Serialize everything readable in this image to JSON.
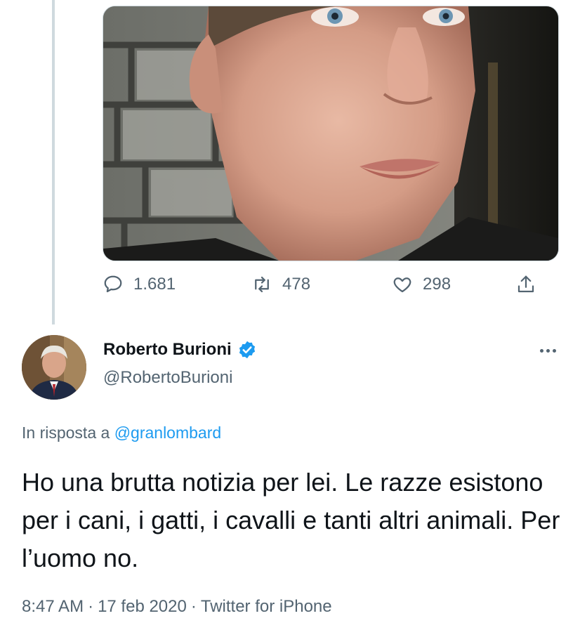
{
  "quoted_tweet": {
    "stats": {
      "replies": "1.681",
      "retweets": "478",
      "likes": "298"
    }
  },
  "tweet": {
    "author": {
      "display_name": "Roberto Burioni",
      "handle": "@RobertoBurioni",
      "verified": true
    },
    "reply_prefix": "In risposta a",
    "reply_to": "@granlombard",
    "text": "Ho una brutta notizia per lei. Le razze esistono per i cani, i gatti, i cavalli e tanti altri animali. Per l’uomo no.",
    "time": "8:47 AM",
    "date": "17 feb 2020",
    "source": "Twitter for iPhone",
    "separator": "·"
  },
  "icons": {
    "reply": "speech-bubble-icon",
    "retweet": "retweet-arrows-icon",
    "like": "heart-icon",
    "share": "share-upload-icon",
    "verified": "verified-badge-icon",
    "more": "more-dots-icon"
  },
  "colors": {
    "accent": "#1d9bf0",
    "secondary_text": "#536471",
    "primary_text": "#0f1419"
  }
}
